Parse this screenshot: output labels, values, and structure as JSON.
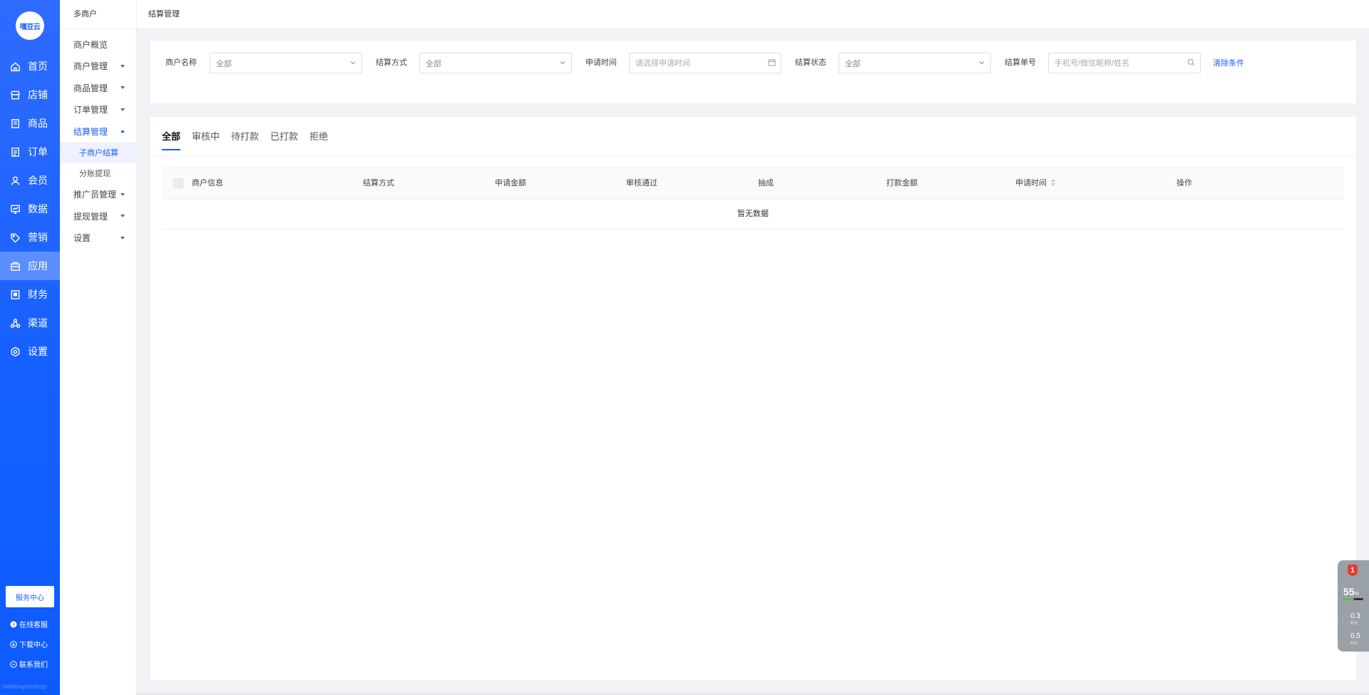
{
  "brand": {
    "logo_text": "嘿豆云",
    "watermark": "heidouyunshop"
  },
  "main_nav": [
    {
      "label": "首页",
      "icon": "home-icon"
    },
    {
      "label": "店铺",
      "icon": "store-icon"
    },
    {
      "label": "商品",
      "icon": "goods-icon"
    },
    {
      "label": "订单",
      "icon": "order-icon"
    },
    {
      "label": "会员",
      "icon": "member-icon"
    },
    {
      "label": "数据",
      "icon": "data-icon"
    },
    {
      "label": "营销",
      "icon": "tag-icon"
    },
    {
      "label": "应用",
      "icon": "app-icon",
      "active": true
    },
    {
      "label": "财务",
      "icon": "finance-icon"
    },
    {
      "label": "渠道",
      "icon": "channel-icon"
    },
    {
      "label": "设置",
      "icon": "gear-icon"
    }
  ],
  "side_bottom": {
    "service_center": "服务中心",
    "online_service": "在线客服",
    "download_center": "下载中心",
    "contact_us": "联系我们"
  },
  "sub_nav": {
    "title": "多商户",
    "items": [
      {
        "label": "商户概览",
        "caret": false
      },
      {
        "label": "商户管理",
        "caret": true
      },
      {
        "label": "商品管理",
        "caret": true
      },
      {
        "label": "订单管理",
        "caret": true
      },
      {
        "label": "结算管理",
        "caret": true,
        "open": true
      },
      {
        "label": "子商户结算",
        "sub": true,
        "active": true
      },
      {
        "label": "分账提现",
        "sub": true
      },
      {
        "label": "推广员管理",
        "caret": true
      },
      {
        "label": "提现管理",
        "caret": true
      },
      {
        "label": "设置",
        "caret": true
      }
    ]
  },
  "header": {
    "breadcrumb": "结算管理"
  },
  "filters": {
    "merchant_name": {
      "label": "商户名称",
      "value": "全部"
    },
    "settle_method": {
      "label": "结算方式",
      "value": "全部"
    },
    "apply_time": {
      "label": "申请时间",
      "placeholder": "请选择申请时间"
    },
    "settle_status": {
      "label": "结算状态",
      "value": "全部"
    },
    "settle_no": {
      "label": "结算单号",
      "placeholder": "手机号/微信昵称/姓名"
    },
    "clear": "清除条件"
  },
  "tabs": [
    {
      "label": "全部",
      "active": true
    },
    {
      "label": "审核中"
    },
    {
      "label": "待打款"
    },
    {
      "label": "已打款"
    },
    {
      "label": "拒绝"
    }
  ],
  "table": {
    "columns": [
      "商户信息",
      "结算方式",
      "申请金额",
      "审核通过",
      "抽成",
      "打款金额",
      "申请时间",
      "操作"
    ],
    "empty_text": "暂无数据"
  },
  "widget": {
    "badge": "1",
    "percent": "55",
    "percent_unit": "%",
    "cpu_fill": 0.55,
    "upload": "0.3",
    "download": "0.5",
    "speed_unit": "K/s"
  }
}
